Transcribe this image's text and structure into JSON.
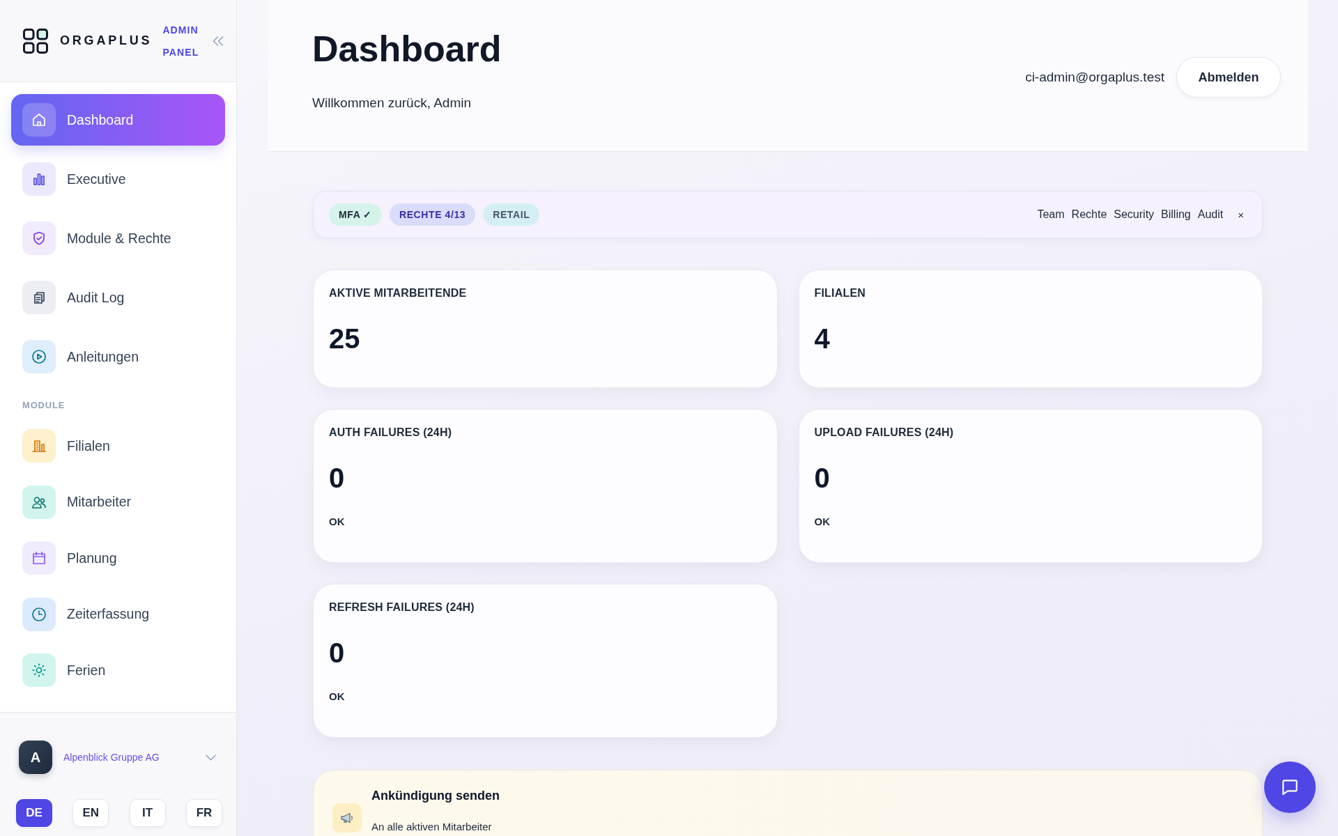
{
  "sidebar": {
    "brand": {
      "name": "ORGAPLUS",
      "badge": "ADMIN PANEL"
    },
    "nav": [
      {
        "label": "Dashboard",
        "selected": true
      },
      {
        "label": "Executive",
        "selected": false
      },
      {
        "label": "Module & Rechte",
        "selected": false
      },
      {
        "label": "Audit Log",
        "selected": false
      },
      {
        "label": "Anleitungen",
        "selected": false
      }
    ],
    "section_label": "MODULE",
    "modules": [
      {
        "label": "Filialen",
        "selected": false
      },
      {
        "label": "Mitarbeiter",
        "selected": false
      },
      {
        "label": "Planung",
        "selected": false
      },
      {
        "label": "Zeiterfassung",
        "selected": false
      },
      {
        "label": "Ferien",
        "selected": false
      }
    ],
    "organization": {
      "avatar_initial": "A",
      "name": "Alpenblick Gruppe AG"
    },
    "languages": [
      {
        "label": "DE",
        "selected": true
      },
      {
        "label": "EN",
        "selected": false
      },
      {
        "label": "IT",
        "selected": false
      },
      {
        "label": "FR",
        "selected": false
      }
    ]
  },
  "header": {
    "title": "Dashboard",
    "subtitle": "Willkommen zurück, Admin",
    "user_email": "ci-admin@orgaplus.test",
    "logout_button": "Abmelden"
  },
  "status_bar": {
    "chips": [
      {
        "label": "MFA ✓",
        "color": "#d5f3ea"
      },
      {
        "label": "RECHTE 4/13",
        "color": "#dadcfb"
      },
      {
        "label": "RETAIL",
        "color": "#d4eff4"
      }
    ],
    "links": [
      "Team",
      "Rechte",
      "Security",
      "Billing",
      "Audit"
    ],
    "close": "×"
  },
  "stats": [
    {
      "label": "AKTIVE MITARBEITENDE",
      "value": "25"
    },
    {
      "label": "FILIALEN",
      "value": "4"
    },
    {
      "label": "AUTH FAILURES (24H)",
      "value": "0",
      "status": "OK"
    },
    {
      "label": "UPLOAD FAILURES (24H)",
      "value": "0",
      "status": "OK"
    },
    {
      "label": "REFRESH FAILURES (24H)",
      "value": "0",
      "status": "OK"
    }
  ],
  "announcement": {
    "title": "Ankündigung senden",
    "subtitle": "An alle aktiven Mitarbeiter"
  }
}
